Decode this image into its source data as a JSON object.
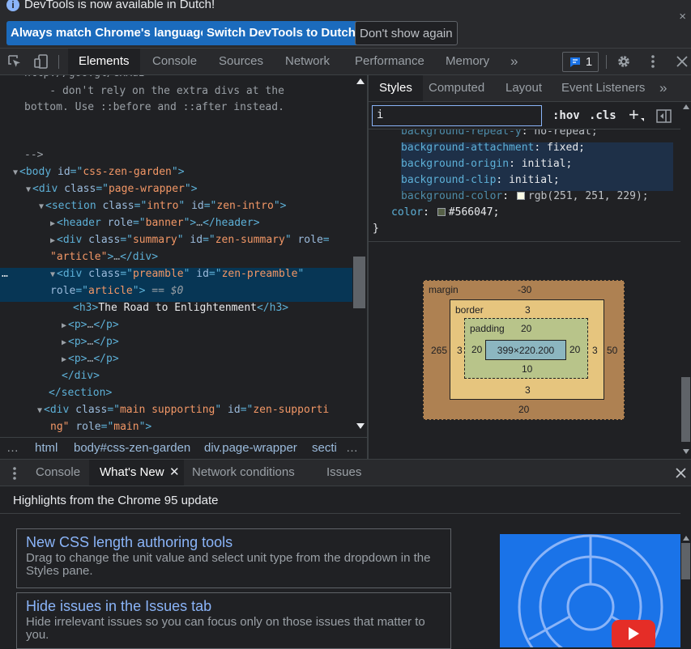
{
  "infobar": {
    "message": "DevTools is now available in Dutch!",
    "buttons": [
      "Always match Chrome's language",
      "Switch DevTools to Dutch",
      "Don't show again"
    ],
    "close": "×"
  },
  "main_tabs": {
    "tabs": [
      "Elements",
      "Console",
      "Sources",
      "Network",
      "Performance",
      "Memory"
    ],
    "more": "»",
    "issues_count": "1"
  },
  "elements": {
    "lines": [
      {
        "parts": [
          [
            "cm",
            "http://goo.gl/GxXuI"
          ]
        ]
      },
      {
        "parts": [
          [
            "cm",
            "    - don't rely on the extra divs at the"
          ]
        ]
      },
      {
        "parts": [
          [
            "cm",
            "bottom. Use ::before and ::after instead."
          ]
        ]
      },
      {
        "parts": [
          [
            "cm",
            ""
          ]
        ]
      },
      {
        "parts": [
          [
            "cm",
            "-->"
          ]
        ]
      },
      {
        "parts": [
          [
            "tri",
            "▼"
          ],
          [
            "tag",
            "<body "
          ],
          [
            "an",
            "id"
          ],
          [
            "tag",
            "=\""
          ],
          [
            "av",
            "css-zen-garden"
          ],
          [
            "tag",
            "\">"
          ]
        ]
      },
      {
        "parts": [
          [
            "tri",
            "▼"
          ],
          [
            "tag",
            "<div "
          ],
          [
            "an",
            "class"
          ],
          [
            "tag",
            "=\""
          ],
          [
            "av",
            "page-wrapper"
          ],
          [
            "tag",
            "\">"
          ]
        ]
      },
      {
        "parts": [
          [
            "tri",
            "▼"
          ],
          [
            "tag",
            "<section "
          ],
          [
            "an",
            "class"
          ],
          [
            "tag",
            "=\""
          ],
          [
            "av",
            "intro"
          ],
          [
            "tag",
            "\" "
          ],
          [
            "an",
            "id"
          ],
          [
            "tag",
            "=\""
          ],
          [
            "av",
            "zen-intro"
          ],
          [
            "tag",
            "\">"
          ]
        ]
      },
      {
        "parts": [
          [
            "tri",
            "▶"
          ],
          [
            "tag",
            "<header "
          ],
          [
            "an",
            "role"
          ],
          [
            "tag",
            "=\""
          ],
          [
            "av",
            "banner"
          ],
          [
            "tag",
            "\">"
          ],
          [
            "cm",
            "…"
          ],
          [
            "tag",
            "</header>"
          ]
        ]
      },
      {
        "parts": [
          [
            "tri",
            "▶"
          ],
          [
            "tag",
            "<div "
          ],
          [
            "an",
            "class"
          ],
          [
            "tag",
            "=\""
          ],
          [
            "av",
            "summary"
          ],
          [
            "tag",
            "\" "
          ],
          [
            "an",
            "id"
          ],
          [
            "tag",
            "=\""
          ],
          [
            "av",
            "zen-summary"
          ],
          [
            "tag",
            "\" "
          ],
          [
            "an",
            "role"
          ],
          [
            "tag",
            "="
          ]
        ]
      },
      {
        "parts": [
          [
            "av",
            "\"article\""
          ],
          [
            "tag",
            ">"
          ],
          [
            "cm",
            "…"
          ],
          [
            "tag",
            "</div>"
          ]
        ]
      },
      {
        "parts": [
          [
            "tri",
            "▼"
          ],
          [
            "tag",
            "<div "
          ],
          [
            "an",
            "class"
          ],
          [
            "tag",
            "=\""
          ],
          [
            "av",
            "preamble"
          ],
          [
            "tag",
            "\" "
          ],
          [
            "an",
            "id"
          ],
          [
            "tag",
            "=\""
          ],
          [
            "av",
            "zen-preamble"
          ],
          [
            "tag",
            "\""
          ]
        ]
      },
      {
        "parts": [
          [
            "an",
            "role"
          ],
          [
            "tag",
            "=\""
          ],
          [
            "av",
            "article"
          ],
          [
            "tag",
            "\">"
          ],
          [
            "cm",
            " == $0"
          ]
        ]
      },
      {
        "parts": [
          [
            "tag",
            "<h3>"
          ],
          [
            "text",
            "The Road to Enlightenment"
          ],
          [
            "tag",
            "</h3>"
          ]
        ]
      },
      {
        "parts": [
          [
            "tri",
            "▶"
          ],
          [
            "tag",
            "<p>"
          ],
          [
            "cm",
            "…"
          ],
          [
            "tag",
            "</p>"
          ]
        ]
      },
      {
        "parts": [
          [
            "tri",
            "▶"
          ],
          [
            "tag",
            "<p>"
          ],
          [
            "cm",
            "…"
          ],
          [
            "tag",
            "</p>"
          ]
        ]
      },
      {
        "parts": [
          [
            "tri",
            "▶"
          ],
          [
            "tag",
            "<p>"
          ],
          [
            "cm",
            "…"
          ],
          [
            "tag",
            "</p>"
          ]
        ]
      },
      {
        "parts": [
          [
            "tag",
            "</div>"
          ]
        ]
      },
      {
        "parts": [
          [
            "tag",
            "</section>"
          ]
        ]
      },
      {
        "parts": [
          [
            "tri",
            "▼"
          ],
          [
            "tag",
            "<div "
          ],
          [
            "an",
            "class"
          ],
          [
            "tag",
            "=\""
          ],
          [
            "av",
            "main supporting"
          ],
          [
            "tag",
            "\" "
          ],
          [
            "an",
            "id"
          ],
          [
            "tag",
            "=\""
          ],
          [
            "av",
            "zen-supporti"
          ]
        ]
      },
      {
        "parts": [
          [
            "av",
            "ng\""
          ],
          [
            "tag",
            " "
          ],
          [
            "an",
            "role"
          ],
          [
            "tag",
            "=\""
          ],
          [
            "av",
            "main"
          ],
          [
            "tag",
            "\">"
          ]
        ]
      }
    ],
    "selected_marker": "…"
  },
  "breadcrumb": {
    "items": [
      "…",
      "html",
      "body#css-zen-garden",
      "div.page-wrapper",
      "secti",
      "…"
    ]
  },
  "styles": {
    "tabs": [
      "Styles",
      "Computed",
      "Layout",
      "Event Listeners"
    ],
    "more": "»",
    "filter_value": "i",
    "hov": ":hov",
    "cls": ".cls",
    "plus": "+",
    "rules": [
      {
        "prop": "background-repeat-y",
        "value": "no-repeat;",
        "indent": 2,
        "swatch": null
      },
      {
        "prop": "background-attachment",
        "value": "fixed;",
        "indent": 2,
        "swatch": null
      },
      {
        "prop": "background-origin",
        "value": "initial;",
        "indent": 2,
        "swatch": null
      },
      {
        "prop": "background-clip",
        "value": "initial;",
        "indent": 2,
        "swatch": null
      },
      {
        "prop": "background-color",
        "value": "rgb(251, 251, 229);",
        "indent": 2,
        "swatch": "#fbfbe5"
      },
      {
        "prop": "color",
        "value": "#566047;",
        "indent": 1,
        "swatch": "#566047"
      }
    ],
    "close_brace": "}"
  },
  "box_model": {
    "margin_label": "margin",
    "margin_top": "-30",
    "margin_left": "265",
    "margin_right": "50",
    "margin_bottom": "20",
    "border_label": "border",
    "border_top": "3",
    "border_left": "3",
    "border_right": "3",
    "border_bottom": "3",
    "padding_label": "padding",
    "padding_top": "20",
    "padding_left": "20",
    "padding_right": "20",
    "padding_bottom": "10",
    "content": "399×220.200",
    "colors": {
      "margin": "#ae8152",
      "border": "#e6c57e",
      "padding": "#b8c48a",
      "content": "#8cb6c0"
    }
  },
  "drawer": {
    "tabs": [
      "Console",
      "What's New",
      "Network conditions",
      "Issues"
    ],
    "active_tab": "What's New",
    "heading": "Highlights from the Chrome 95 update",
    "cards": [
      {
        "title": "New CSS length authoring tools",
        "desc": "Drag to change the unit value and select unit type from the dropdown in the Styles pane."
      },
      {
        "title": "Hide issues in the Issues tab",
        "desc": "Hide irrelevant issues so you can focus only on those issues that matter to you."
      }
    ]
  }
}
